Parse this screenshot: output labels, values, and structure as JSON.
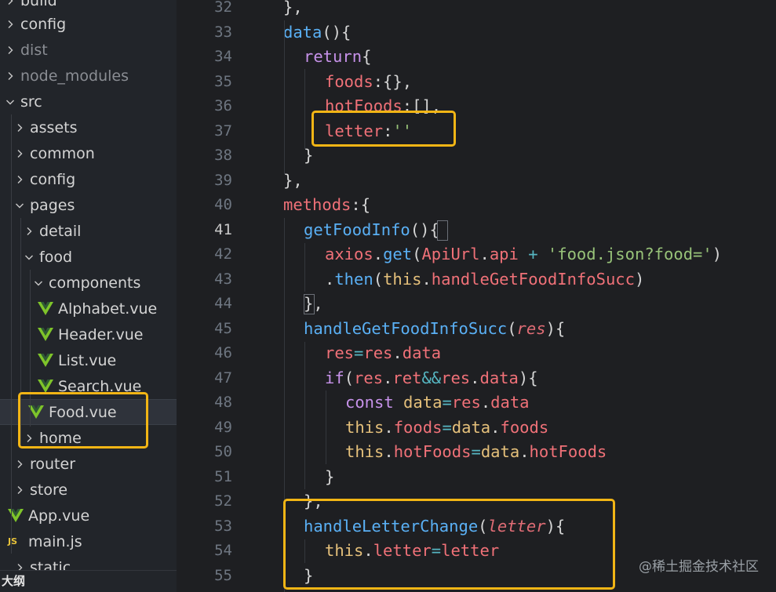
{
  "explorer": {
    "items": [
      {
        "label": "build",
        "kind": "folder",
        "dim": false
      },
      {
        "label": "config",
        "kind": "folder",
        "dim": false
      },
      {
        "label": "dist",
        "kind": "folder",
        "dim": true
      },
      {
        "label": "node_modules",
        "kind": "folder",
        "dim": true
      },
      {
        "label": "src",
        "kind": "folder-open",
        "dim": false
      },
      {
        "label": "assets",
        "kind": "folder",
        "dim": false
      },
      {
        "label": "common",
        "kind": "folder",
        "dim": false
      },
      {
        "label": "config",
        "kind": "folder",
        "dim": false
      },
      {
        "label": "pages",
        "kind": "folder-open",
        "dim": false
      },
      {
        "label": "detail",
        "kind": "folder",
        "dim": false
      },
      {
        "label": "food",
        "kind": "folder-open",
        "dim": false
      },
      {
        "label": "components",
        "kind": "folder-open",
        "dim": false
      },
      {
        "label": "Alphabet.vue",
        "kind": "vue",
        "dim": false
      },
      {
        "label": "Header.vue",
        "kind": "vue",
        "dim": false
      },
      {
        "label": "List.vue",
        "kind": "vue",
        "dim": false
      },
      {
        "label": "Search.vue",
        "kind": "vue",
        "dim": false
      },
      {
        "label": "Food.vue",
        "kind": "vue",
        "dim": false,
        "selected": true
      },
      {
        "label": "home",
        "kind": "folder",
        "dim": false
      },
      {
        "label": "router",
        "kind": "folder",
        "dim": false
      },
      {
        "label": "store",
        "kind": "folder",
        "dim": false
      },
      {
        "label": "App.vue",
        "kind": "vue",
        "dim": false
      },
      {
        "label": "main.js",
        "kind": "js",
        "dim": false
      },
      {
        "label": "static",
        "kind": "folder",
        "dim": false
      }
    ],
    "outline_label": "大纲",
    "js_badge": "JS"
  },
  "editor": {
    "active_line": 41,
    "line_numbers": [
      "32",
      "33",
      "34",
      "35",
      "36",
      "37",
      "38",
      "39",
      "40",
      "41",
      "42",
      "43",
      "44",
      "45",
      "46",
      "47",
      "48",
      "49",
      "50",
      "51",
      "52",
      "53",
      "54",
      "55"
    ]
  },
  "code": {
    "l32": "},",
    "l33_name": "data",
    "l33_rest": "(){",
    "l34_kw": "return",
    "l34_rest": "{",
    "l35_prop": "foods",
    "l35_rest": ":{},",
    "l36_prop": "hotFoods",
    "l36_rest": ":[],",
    "l37_prop": "letter",
    "l37_colon": ":",
    "l37_str": "''",
    "l38": "}",
    "l39": "},",
    "l40_prop": "methods",
    "l40_rest": ":{",
    "l41_name": "getFoodInfo",
    "l41_rest": "(){",
    "l42_obj": "axios",
    "l42_dot": ".",
    "l42_fn": "get",
    "l42_open": "(",
    "l42_api": "ApiUrl",
    "l42_dot2": ".",
    "l42_prop": "api",
    "l42_plus": " + ",
    "l42_str": "'food.json?food='",
    "l42_close": ")",
    "l43_dot": ".",
    "l43_fn": "then",
    "l43_open": "(",
    "l43_this": "this",
    "l43_dot2": ".",
    "l43_prop": "handleGetFoodInfoSucc",
    "l43_close": ")",
    "l44": "},",
    "l45_name": "handleGetFoodInfoSucc",
    "l45_open": "(",
    "l45_param": "res",
    "l45_close": "){",
    "l46_var": "res",
    "l46_eq": "=",
    "l46_var2": "res",
    "l46_dot": ".",
    "l46_prop": "data",
    "l47_kw": "if",
    "l47_open": "(",
    "l47_a": "res",
    "l47_dot": ".",
    "l47_ret": "ret",
    "l47_and": "&&",
    "l47_b": "res",
    "l47_dot2": ".",
    "l47_data": "data",
    "l47_close": "){",
    "l48_kw": "const",
    "l48_var": " data",
    "l48_eq": "=",
    "l48_res": "res",
    "l48_dot": ".",
    "l48_prop": "data",
    "l49_this": "this",
    "l49_dot": ".",
    "l49_prop": "foods",
    "l49_eq": "=",
    "l49_var": "data",
    "l49_dot2": ".",
    "l49_prop2": "foods",
    "l50_this": "this",
    "l50_dot": ".",
    "l50_prop": "hotFoods",
    "l50_eq": "=",
    "l50_var": "data",
    "l50_dot2": ".",
    "l50_prop2": "hotFoods",
    "l51": "}",
    "l52": "},",
    "l53_name": "handleLetterChange",
    "l53_open": "(",
    "l53_param": "letter",
    "l53_close": "){",
    "l54_this": "this",
    "l54_dot": ".",
    "l54_prop": "letter",
    "l54_eq": "=",
    "l54_var": "letter",
    "l55": "}"
  },
  "watermark": "@稀土掘金技术社区",
  "colors": {
    "highlight": "#f2b515",
    "background": "#1e1f22",
    "sidebar": "#22252a"
  }
}
